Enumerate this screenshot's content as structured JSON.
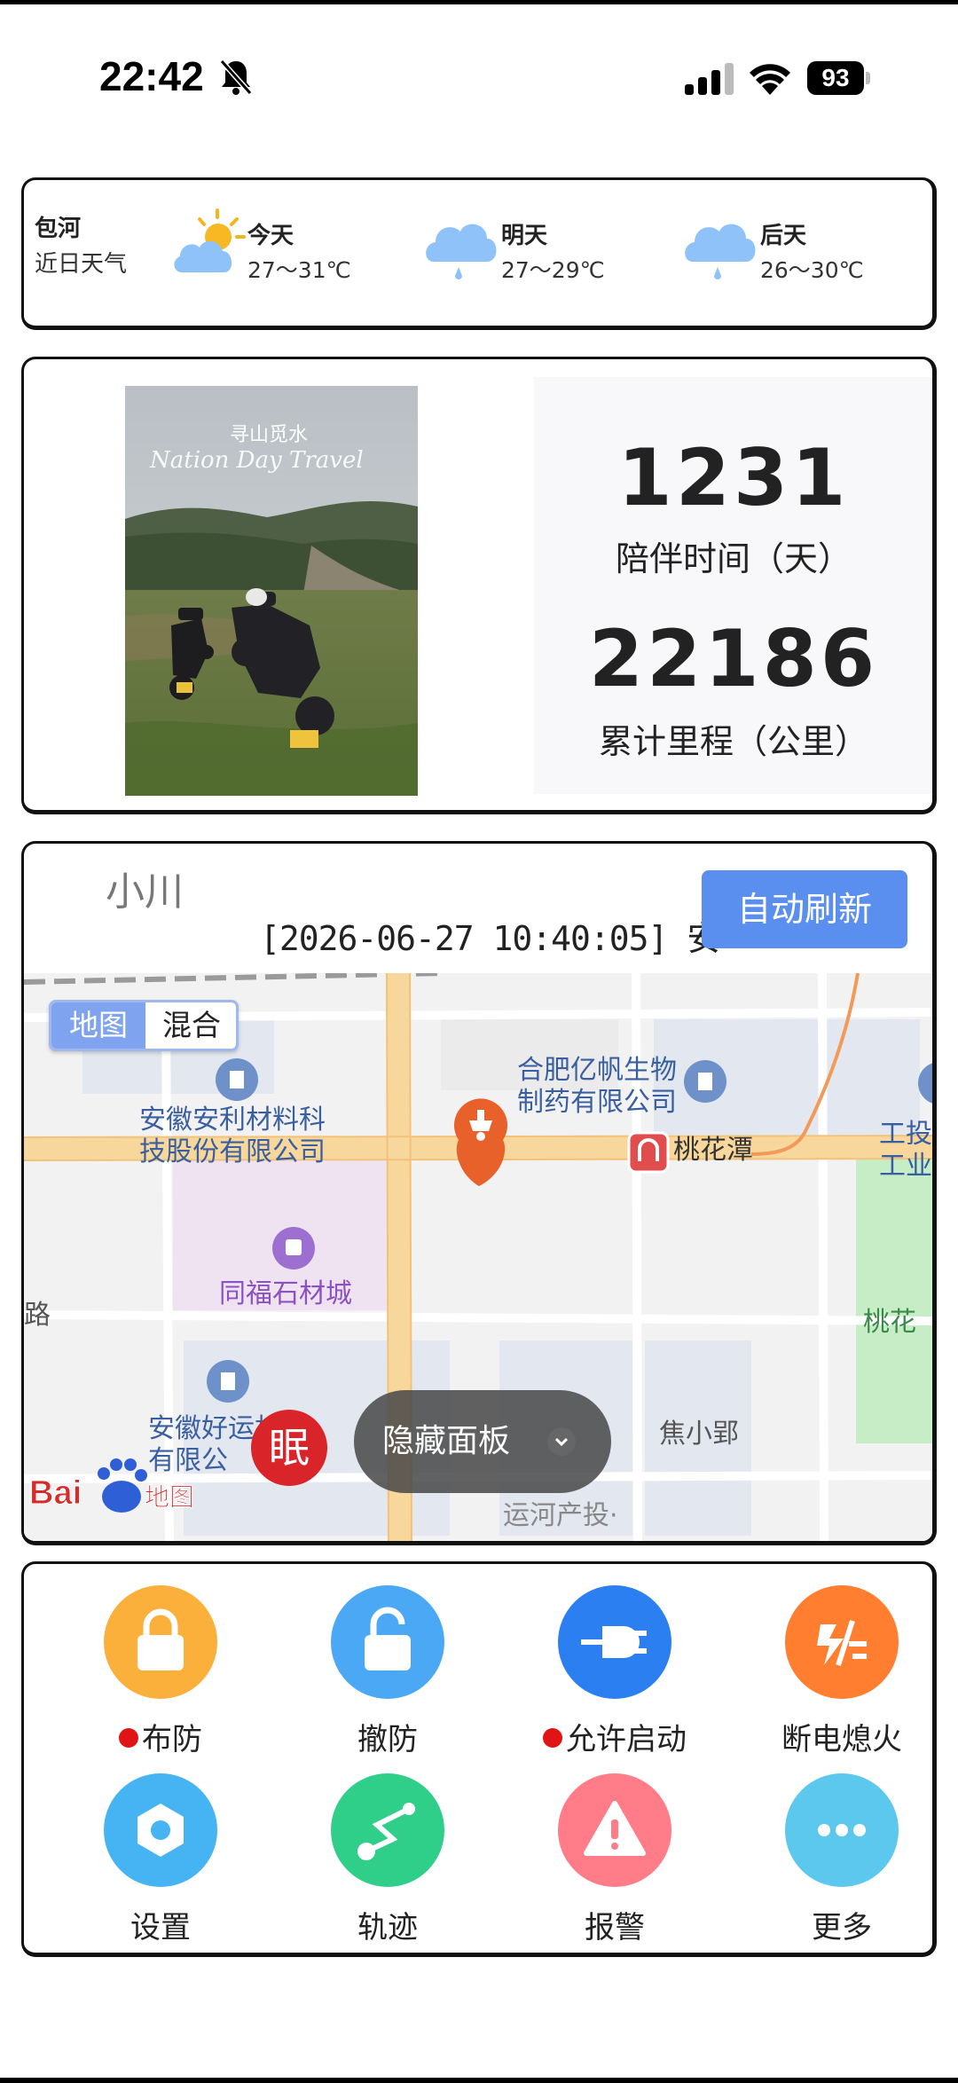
{
  "status_bar": {
    "time": "22:42",
    "battery": "93",
    "icons": [
      "bell-mute-icon",
      "signal-icon",
      "wifi-icon",
      "battery-icon"
    ]
  },
  "weather": {
    "city": "包河",
    "subtitle": "近日天气",
    "days": [
      {
        "label": "今天",
        "temp": "27～31℃",
        "icon": "partly-cloudy-icon"
      },
      {
        "label": "明天",
        "temp": "27～29℃",
        "icon": "rain-cloud-icon"
      },
      {
        "label": "后天",
        "temp": "26～30℃",
        "icon": "rain-cloud-icon"
      }
    ]
  },
  "stats": {
    "photo_caption_lines": [
      "寻山觅水",
      "Nation Day Travel"
    ],
    "companion_days": "1231",
    "companion_label": "陪伴时间（天）",
    "mileage": "22186",
    "mileage_label": "累计里程（公里）"
  },
  "vehicle": {
    "name": "小川",
    "status_line": "[2026-06-27 10:40:05] 安徽",
    "refresh_label": "自动刷新"
  },
  "map": {
    "toggle_map": "地图",
    "toggle_mixed": "混合",
    "labels": {
      "poi1": "安徽安利材料科\n技股份有限公司",
      "poi2": "合肥亿帆生物\n制药有限公司",
      "poi3": "桃花潭",
      "poi4": "同福石材城",
      "poi5": "工投\n工业",
      "poi6": "路",
      "poi7": "桃花",
      "poi8": "安徽好运机械\n有限公",
      "poi9": "焦小郢",
      "poi10": "运河产投·"
    },
    "hide_panel_label": "隐藏面板",
    "sleep_label": "眠",
    "baidu_logo": "Bai地图"
  },
  "actions": [
    {
      "label": "布防",
      "icon": "lock-icon",
      "color": "#fbb03b",
      "dot": true
    },
    {
      "label": "撤防",
      "icon": "unlock-icon",
      "color": "#4aa8f5",
      "dot": false
    },
    {
      "label": "允许启动",
      "icon": "plug-icon",
      "color": "#2b7ff0",
      "dot": true
    },
    {
      "label": "断电熄火",
      "icon": "power-cut-icon",
      "color": "#ff7e2f",
      "dot": false
    },
    {
      "label": "设置",
      "icon": "settings-icon",
      "color": "#46b4f2",
      "dot": false
    },
    {
      "label": "轨迹",
      "icon": "route-icon",
      "color": "#2fcf8a",
      "dot": false
    },
    {
      "label": "报警",
      "icon": "alarm-icon",
      "color": "#ff7c88",
      "dot": false
    },
    {
      "label": "更多",
      "icon": "more-icon",
      "color": "#5cc8ee",
      "dot": false
    }
  ]
}
